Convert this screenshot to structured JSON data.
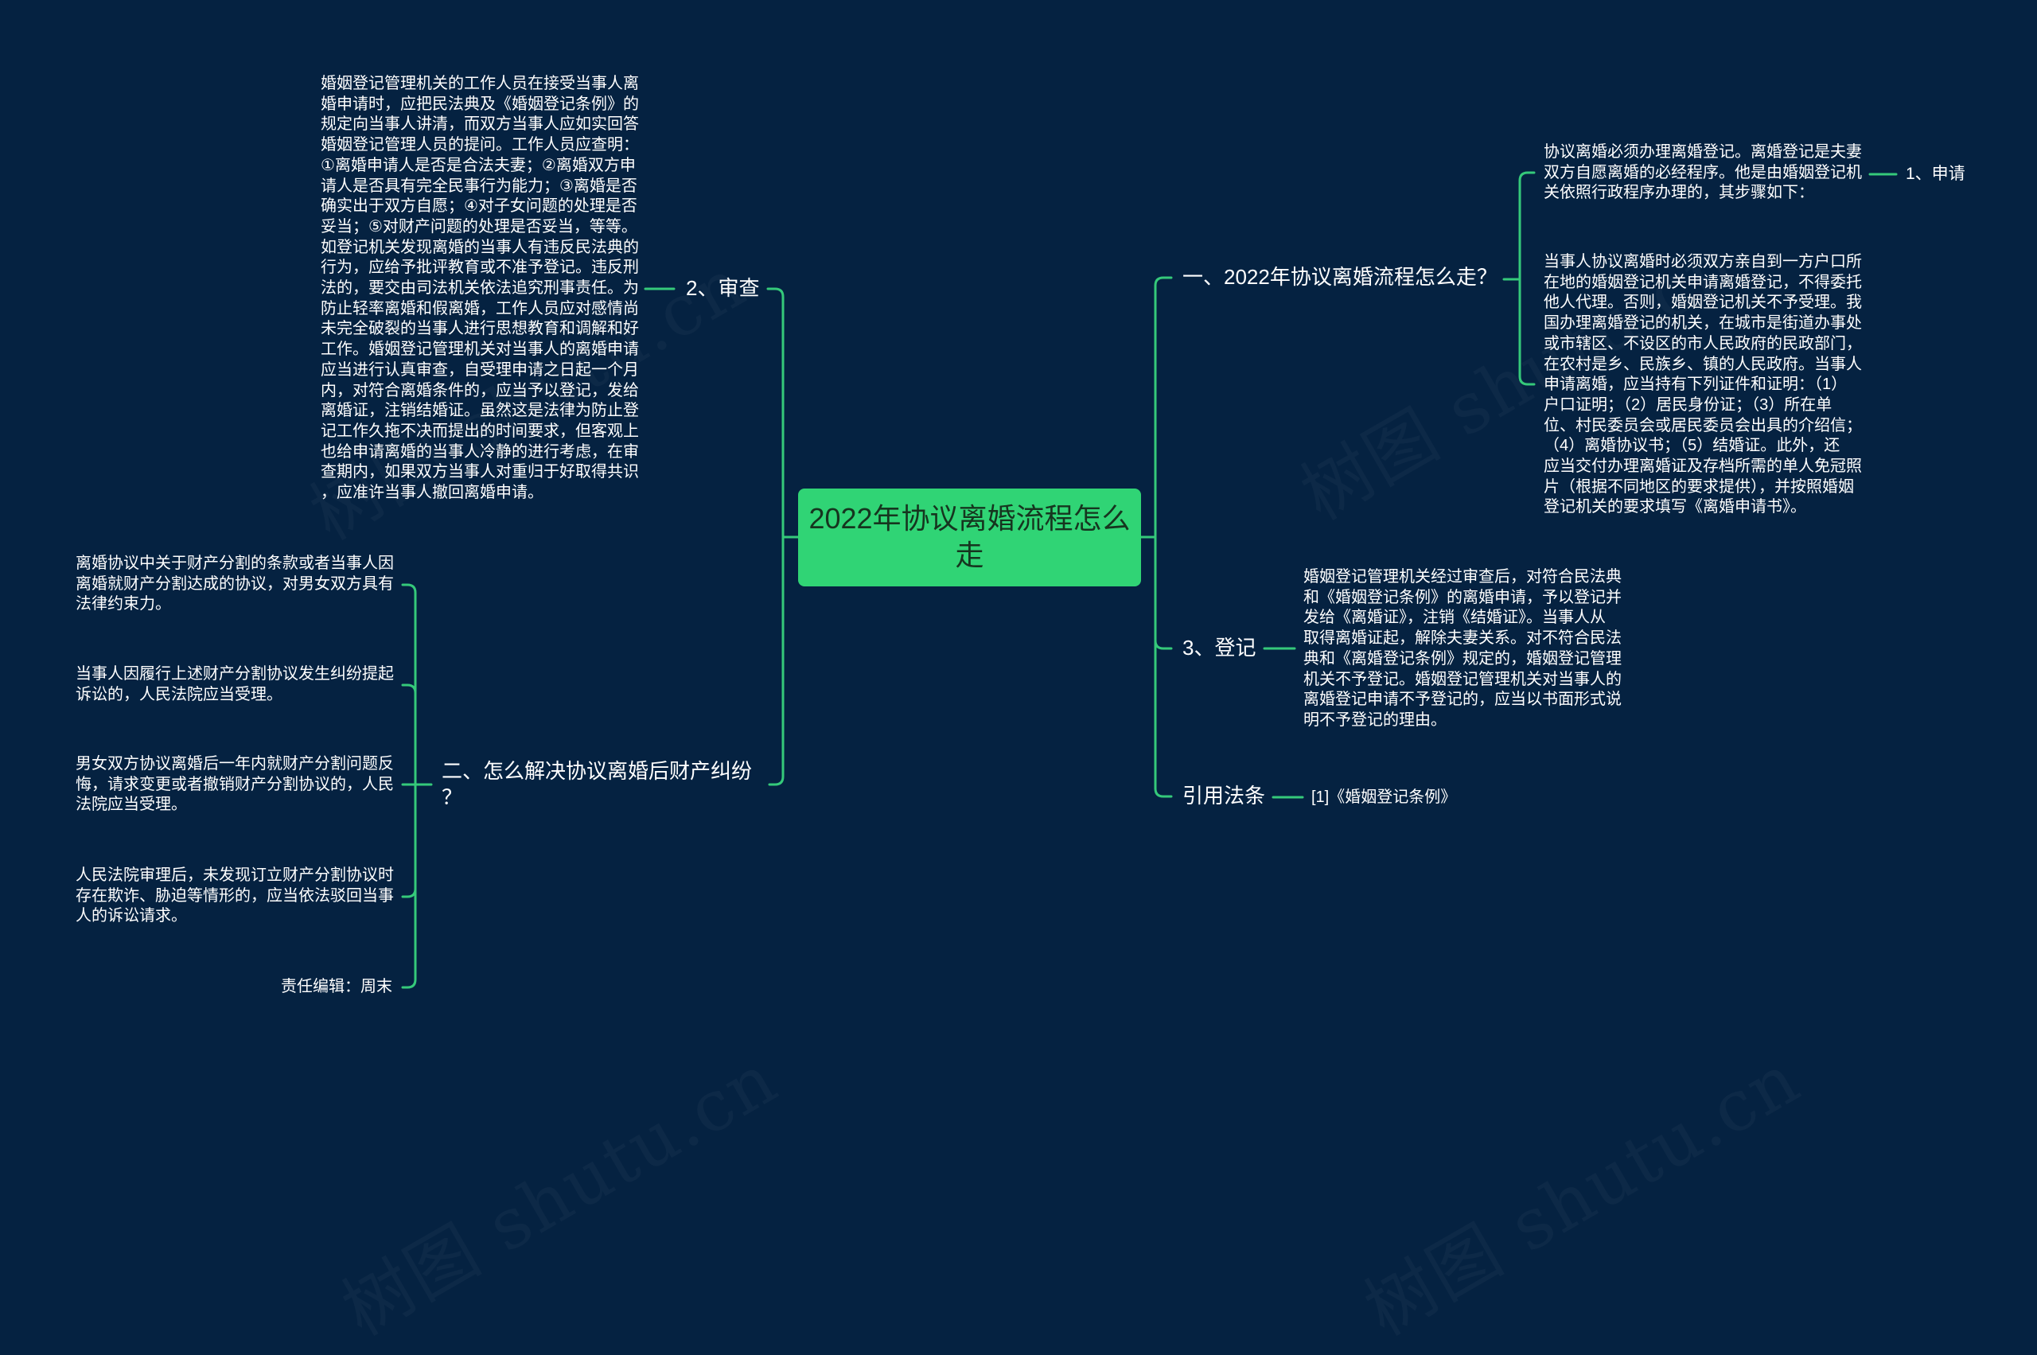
{
  "theme": {
    "background": "#052241",
    "accent": "#30d475",
    "line": "#35c97a",
    "text": "#ffffff",
    "center_text": "#16351f"
  },
  "watermark": {
    "text": "树图 shutu.cn"
  },
  "center": {
    "title_lines": [
      "2022年协议离婚流程怎么",
      "走"
    ]
  },
  "left": {
    "review": {
      "label": "2、审查",
      "detail": {
        "lines": [
          "婚姻登记管理机关的工作人员在接受当事人离",
          "婚申请时，应把民法典及《婚姻登记条例》的",
          "规定向当事人讲清，而双方当事人应如实回答",
          "婚姻登记管理人员的提问。工作人员应查明：",
          "①离婚申请人是否是合法夫妻；②离婚双方申",
          "请人是否具有完全民事行为能力；③离婚是否",
          "确实出于双方自愿；④对子女问题的处理是否",
          "妥当；⑤对财产问题的处理是否妥当，等等。",
          "如登记机关发现离婚的当事人有违反民法典的",
          "行为，应给予批评教育或不准予登记。违反刑",
          "法的，要交由司法机关依法追究刑事责任。为",
          "防止轻率离婚和假离婚，工作人员应对感情尚",
          "未完全破裂的当事人进行思想教育和调解和好",
          "工作。婚姻登记管理机关对当事人的离婚申请",
          "应当进行认真审查，自受理申请之日起一个月",
          "内，对符合离婚条件的，应当予以登记，发给",
          "离婚证，注销结婚证。虽然这是法律为防止登",
          "记工作久拖不决而提出的时间要求，但客观上",
          "也给申请离婚的当事人冷静的进行考虑，在审",
          "查期内，如果双方当事人对重归于好取得共识",
          "，应准许当事人撤回离婚申请。"
        ]
      }
    },
    "property": {
      "label_lines": [
        "二、怎么解决协议离婚后财产纠纷",
        "？"
      ],
      "children": [
        {
          "lines": [
            "离婚协议中关于财产分割的条款或者当事人因",
            "离婚就财产分割达成的协议，对男女双方具有",
            "法律约束力。"
          ]
        },
        {
          "lines": [
            "当事人因履行上述财产分割协议发生纠纷提起",
            "诉讼的，人民法院应当受理。"
          ]
        },
        {
          "lines": [
            "男女双方协议离婚后一年内就财产分割问题反",
            "悔，请求变更或者撤销财产分割协议的，人民",
            "法院应当受理。"
          ]
        },
        {
          "lines": [
            "人民法院审理后，未发现订立财产分割协议时",
            "存在欺诈、胁迫等情形的，应当依法驳回当事",
            "人的诉讼请求。"
          ]
        },
        {
          "lines": [
            "责任编辑：周末"
          ]
        }
      ]
    }
  },
  "right": {
    "process": {
      "label": "一、2022年协议离婚流程怎么走？",
      "children": [
        {
          "lines": [
            "协议离婚必须办理离婚登记。离婚登记是夫妻",
            "双方自愿离婚的必经程序。他是由婚姻登记机",
            "关依照行政程序办理的，其步骤如下："
          ],
          "child": {
            "label": "1、申请"
          }
        },
        {
          "lines": [
            "当事人协议离婚时必须双方亲自到一方户口所",
            "在地的婚姻登记机关申请离婚登记，不得委托",
            "他人代理。否则，婚姻登记机关不予受理。我",
            "国办理离婚登记的机关，在城市是街道办事处",
            "或市辖区、不设区的市人民政府的民政部门，",
            "在农村是乡、民族乡、镇的人民政府。当事人",
            "申请离婚，应当持有下列证件和证明：（1）",
            "户口证明；（2）居民身份证；（3）所在单",
            "位、村民委员会或居民委员会出具的介绍信；",
            "（4）离婚协议书；（5）结婚证。此外，还",
            "应当交付办理离婚证及存档所需的单人免冠照",
            "片（根据不同地区的要求提供），并按照婚姻",
            "登记机关的要求填写《离婚申请书》。"
          ]
        }
      ]
    },
    "registration": {
      "label": "3、登记",
      "detail": {
        "lines": [
          "婚姻登记管理机关经过审查后，对符合民法典",
          "和《婚姻登记条例》的离婚申请，予以登记并",
          "发给《离婚证》，注销《结婚证》。当事人从",
          "取得离婚证起，解除夫妻关系。对不符合民法",
          "典和《离婚登记条例》规定的，婚姻登记管理",
          "机关不予登记。婚姻登记管理机关对当事人的",
          "离婚登记申请不予登记的，应当以书面形式说",
          "明不予登记的理由。"
        ]
      }
    },
    "law": {
      "label": "引用法条",
      "reference": "[1]《婚姻登记条例》"
    }
  }
}
